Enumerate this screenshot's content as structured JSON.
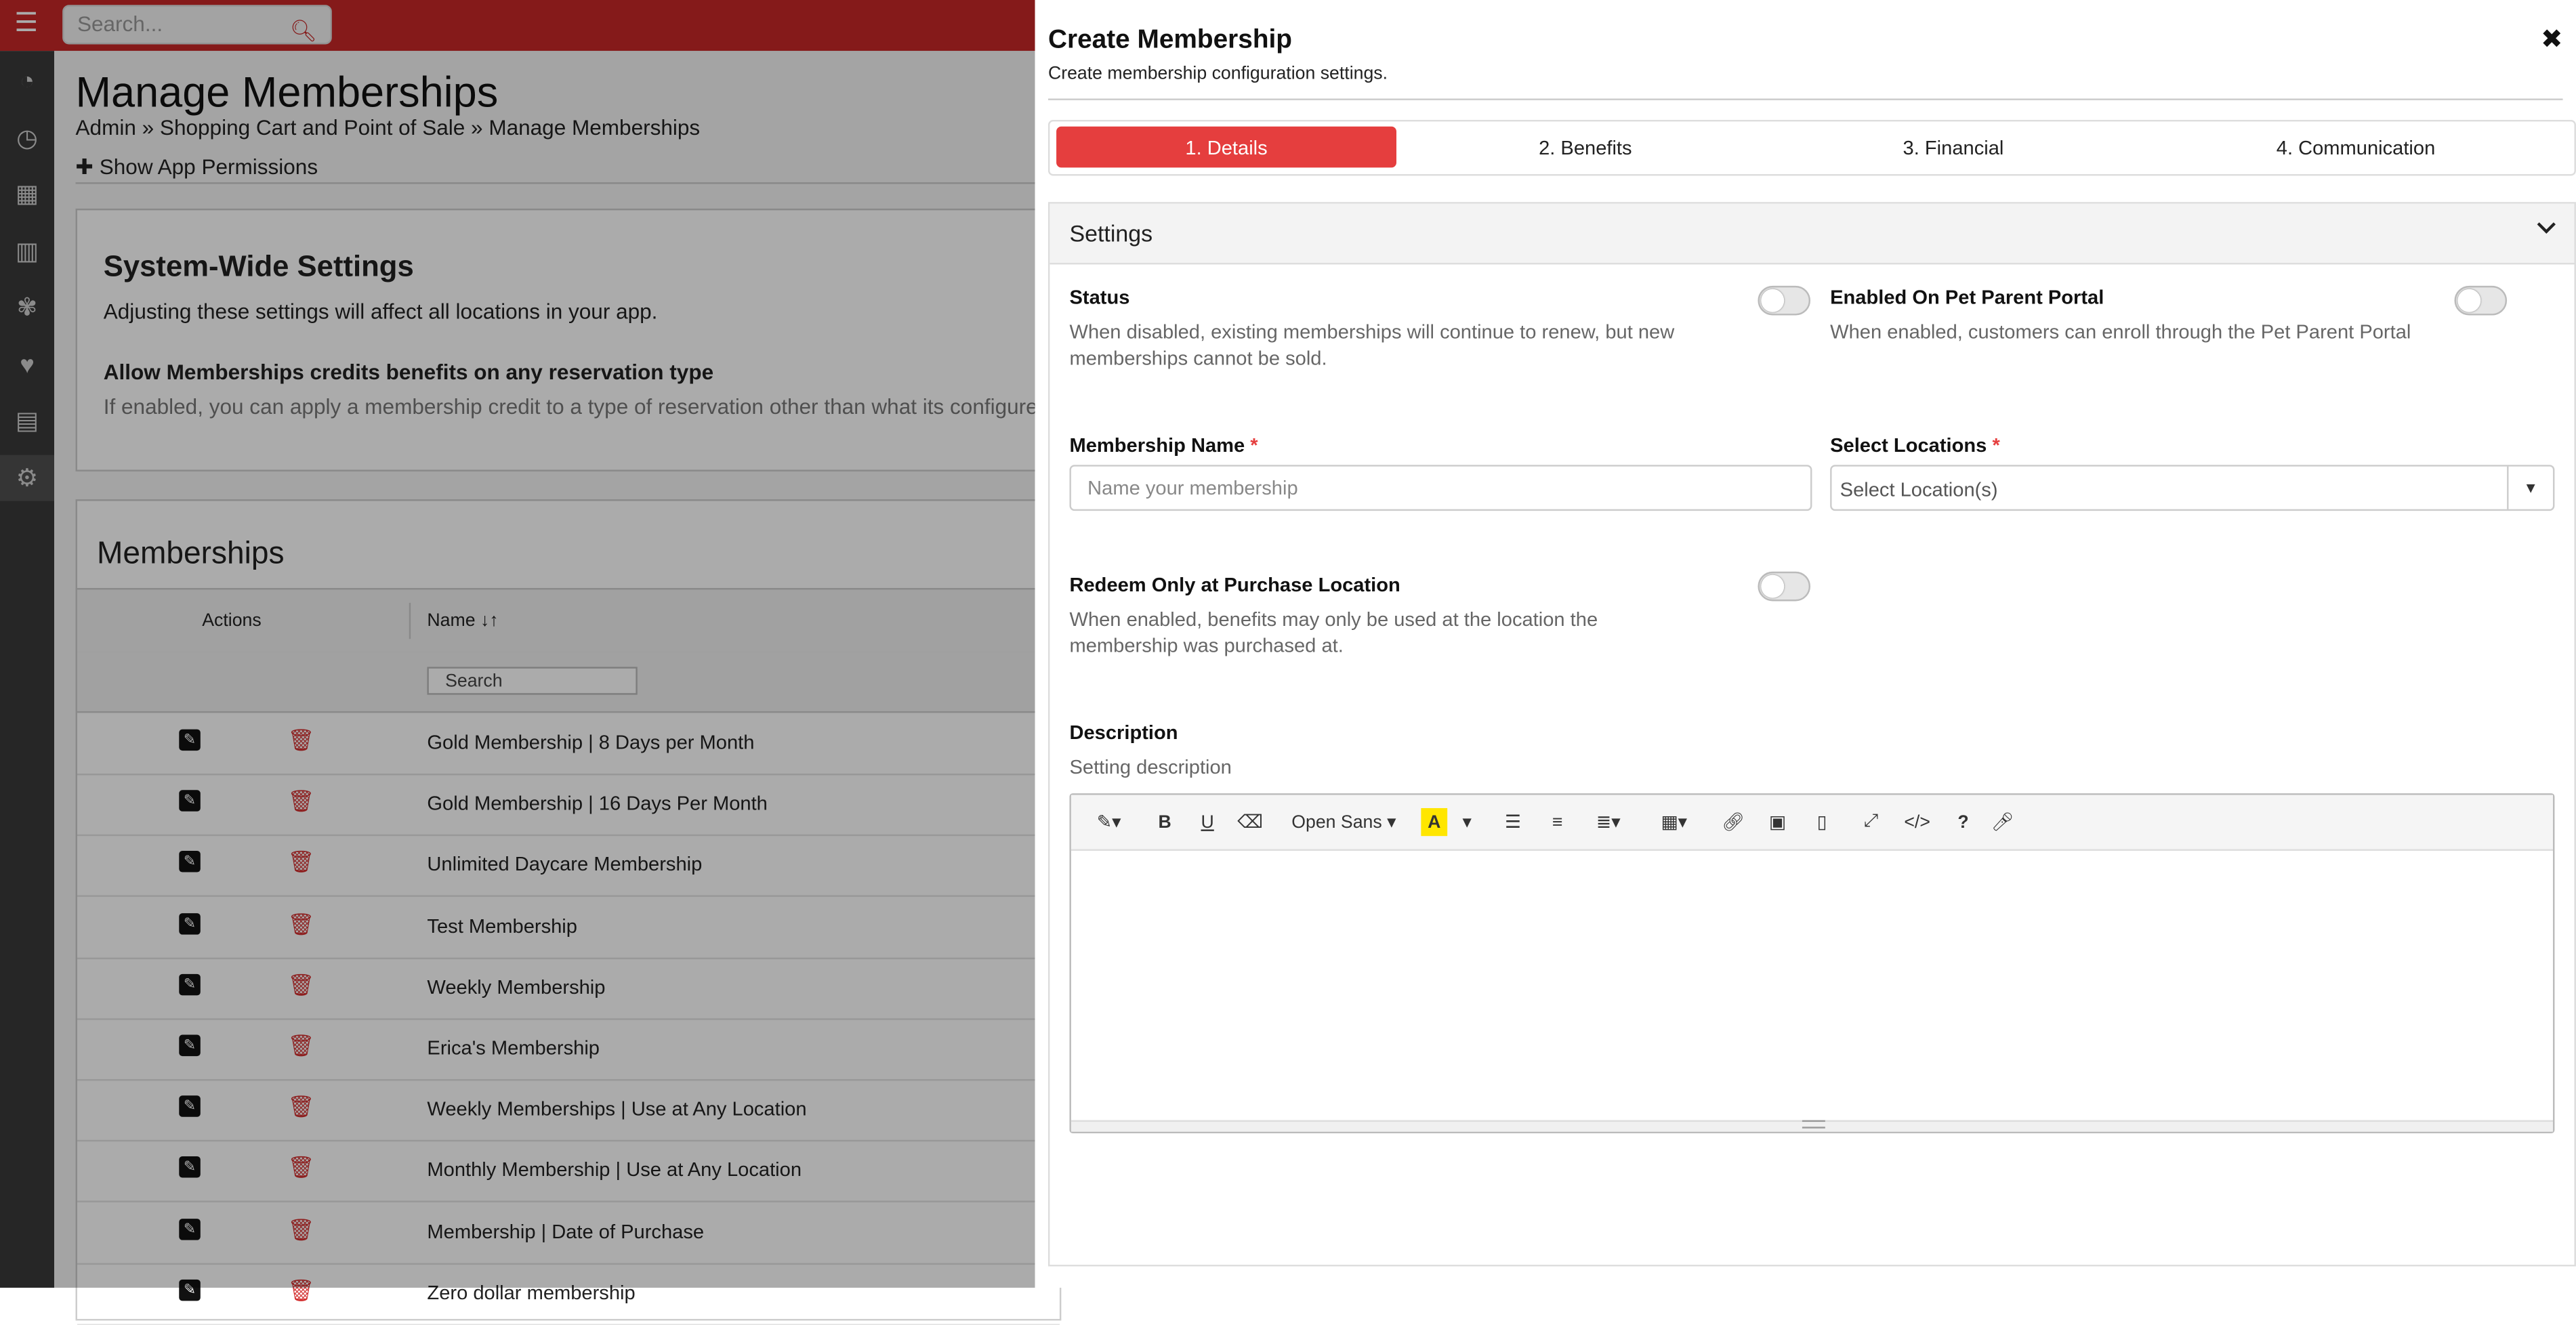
{
  "topbar": {
    "search_placeholder": "Search..."
  },
  "page": {
    "title": "Manage Memberships",
    "breadcrumb": "Admin » Shopping Cart and Point of Sale » Manage Memberships",
    "permissions_link": "Show App Permissions"
  },
  "system_settings": {
    "title": "System-Wide Settings",
    "subtitle": "Adjusting these settings will affect all locations in your app.",
    "option_label": "Allow Memberships credits benefits on any reservation type",
    "option_desc": "If enabled, you can apply a membership credit to a type of reservation other than what its configured for."
  },
  "memberships": {
    "title": "Memberships",
    "columns": {
      "actions": "Actions",
      "name": "Name ↓↑"
    },
    "filter_placeholder": "Search",
    "rows": [
      "Gold Membership | 8 Days per Month",
      "Gold Membership | 16 Days Per Month",
      "Unlimited Daycare Membership",
      "Test Membership",
      "Weekly Membership",
      "Erica's Membership",
      "Weekly Memberships | Use at Any Location",
      "Monthly Membership | Use at Any Location",
      "Membership | Date of Purchase",
      "Zero dollar membership"
    ]
  },
  "panel": {
    "title": "Create Membership",
    "subtitle": "Create membership configuration settings.",
    "steps": [
      "1. Details",
      "2. Benefits",
      "3. Financial",
      "4. Communication"
    ],
    "active_step": 0,
    "section": "Settings",
    "status_label": "Status",
    "status_desc": "When disabled, existing memberships will continue to renew, but new memberships cannot be sold.",
    "portal_label": "Enabled On Pet Parent Portal",
    "portal_desc": "When enabled, customers can enroll through the Pet Parent Portal",
    "name_label": "Membership Name",
    "name_placeholder": "Name your membership",
    "locations_label": "Select Locations",
    "locations_placeholder": "Select Location(s)",
    "redeem_label": "Redeem Only at Purchase Location",
    "redeem_desc": "When enabled, benefits may only be used at the location the membership was purchased at.",
    "description_label": "Description",
    "description_hint": "Setting description",
    "required_mark": "*",
    "editor_font": "Open Sans"
  },
  "colors": {
    "brand_red": "#c62828",
    "active_step": "#e53e3e",
    "trash": "#d32f2f"
  }
}
